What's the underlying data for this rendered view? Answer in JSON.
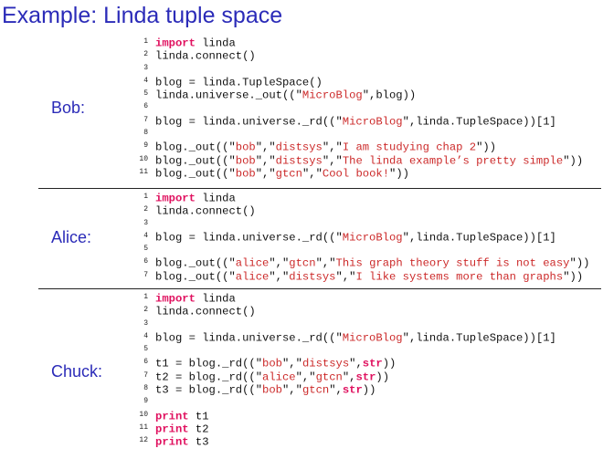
{
  "title": "Example: Linda tuple space",
  "sections": [
    {
      "speaker": "Bob:",
      "lines": [
        {
          "n": "1",
          "parts": [
            {
              "t": "import",
              "c": "kw"
            },
            {
              "t": " linda"
            }
          ]
        },
        {
          "n": "2",
          "parts": [
            {
              "t": "linda.connect()"
            }
          ]
        },
        {
          "n": "3",
          "parts": []
        },
        {
          "n": "4",
          "parts": [
            {
              "t": "blog = linda.TupleSpace()"
            }
          ]
        },
        {
          "n": "5",
          "parts": [
            {
              "t": "linda.universe._out((\""
            },
            {
              "t": "MicroBlog",
              "c": "str"
            },
            {
              "t": "\",blog))"
            }
          ]
        },
        {
          "n": "6",
          "parts": []
        },
        {
          "n": "7",
          "parts": [
            {
              "t": "blog = linda.universe._rd((\""
            },
            {
              "t": "MicroBlog",
              "c": "str"
            },
            {
              "t": "\",linda.TupleSpace))[1]"
            }
          ]
        },
        {
          "n": "8",
          "parts": []
        },
        {
          "n": "9",
          "parts": [
            {
              "t": "blog._out((\""
            },
            {
              "t": "bob",
              "c": "str"
            },
            {
              "t": "\",\""
            },
            {
              "t": "distsys",
              "c": "str"
            },
            {
              "t": "\",\""
            },
            {
              "t": "I am studying chap 2",
              "c": "str"
            },
            {
              "t": "\"))"
            }
          ]
        },
        {
          "n": "10",
          "parts": [
            {
              "t": "blog._out((\""
            },
            {
              "t": "bob",
              "c": "str"
            },
            {
              "t": "\",\""
            },
            {
              "t": "distsys",
              "c": "str"
            },
            {
              "t": "\",\""
            },
            {
              "t": "The linda example’s pretty simple",
              "c": "str"
            },
            {
              "t": "\"))"
            }
          ]
        },
        {
          "n": "11",
          "parts": [
            {
              "t": "blog._out((\""
            },
            {
              "t": "bob",
              "c": "str"
            },
            {
              "t": "\",\""
            },
            {
              "t": "gtcn",
              "c": "str"
            },
            {
              "t": "\",\""
            },
            {
              "t": "Cool book!",
              "c": "str"
            },
            {
              "t": "\"))"
            }
          ]
        }
      ]
    },
    {
      "speaker": "Alice:",
      "lines": [
        {
          "n": "1",
          "parts": [
            {
              "t": "import",
              "c": "kw"
            },
            {
              "t": " linda"
            }
          ]
        },
        {
          "n": "2",
          "parts": [
            {
              "t": "linda.connect()"
            }
          ]
        },
        {
          "n": "3",
          "parts": []
        },
        {
          "n": "4",
          "parts": [
            {
              "t": "blog = linda.universe._rd((\""
            },
            {
              "t": "MicroBlog",
              "c": "str"
            },
            {
              "t": "\",linda.TupleSpace))[1]"
            }
          ]
        },
        {
          "n": "5",
          "parts": []
        },
        {
          "n": "6",
          "parts": [
            {
              "t": "blog._out((\""
            },
            {
              "t": "alice",
              "c": "str"
            },
            {
              "t": "\",\""
            },
            {
              "t": "gtcn",
              "c": "str"
            },
            {
              "t": "\",\""
            },
            {
              "t": "This graph theory stuff is not easy",
              "c": "str"
            },
            {
              "t": "\"))"
            }
          ]
        },
        {
          "n": "7",
          "parts": [
            {
              "t": "blog._out((\""
            },
            {
              "t": "alice",
              "c": "str"
            },
            {
              "t": "\",\""
            },
            {
              "t": "distsys",
              "c": "str"
            },
            {
              "t": "\",\""
            },
            {
              "t": "I like systems more than graphs",
              "c": "str"
            },
            {
              "t": "\"))"
            }
          ]
        }
      ]
    },
    {
      "speaker": "Chuck:",
      "lines": [
        {
          "n": "1",
          "parts": [
            {
              "t": "import",
              "c": "kw"
            },
            {
              "t": " linda"
            }
          ]
        },
        {
          "n": "2",
          "parts": [
            {
              "t": "linda.connect()"
            }
          ]
        },
        {
          "n": "3",
          "parts": []
        },
        {
          "n": "4",
          "parts": [
            {
              "t": "blog = linda.universe._rd((\""
            },
            {
              "t": "MicroBlog",
              "c": "str"
            },
            {
              "t": "\",linda.TupleSpace))[1]"
            }
          ]
        },
        {
          "n": "5",
          "parts": []
        },
        {
          "n": "6",
          "parts": [
            {
              "t": "t1 = blog._rd((\""
            },
            {
              "t": "bob",
              "c": "str"
            },
            {
              "t": "\",\""
            },
            {
              "t": "distsys",
              "c": "str"
            },
            {
              "t": "\","
            },
            {
              "t": "str",
              "c": "kw"
            },
            {
              "t": "))"
            }
          ]
        },
        {
          "n": "7",
          "parts": [
            {
              "t": "t2 = blog._rd((\""
            },
            {
              "t": "alice",
              "c": "str"
            },
            {
              "t": "\",\""
            },
            {
              "t": "gtcn",
              "c": "str"
            },
            {
              "t": "\","
            },
            {
              "t": "str",
              "c": "kw"
            },
            {
              "t": "))"
            }
          ]
        },
        {
          "n": "8",
          "parts": [
            {
              "t": "t3 = blog._rd((\""
            },
            {
              "t": "bob",
              "c": "str"
            },
            {
              "t": "\",\""
            },
            {
              "t": "gtcn",
              "c": "str"
            },
            {
              "t": "\","
            },
            {
              "t": "str",
              "c": "kw"
            },
            {
              "t": "))"
            }
          ]
        },
        {
          "n": "9",
          "parts": []
        },
        {
          "n": "10",
          "parts": [
            {
              "t": "print",
              "c": "kw"
            },
            {
              "t": " t1"
            }
          ]
        },
        {
          "n": "11",
          "parts": [
            {
              "t": "print",
              "c": "kw"
            },
            {
              "t": " t2"
            }
          ]
        },
        {
          "n": "12",
          "parts": [
            {
              "t": "print",
              "c": "kw"
            },
            {
              "t": " t3"
            }
          ]
        }
      ]
    }
  ]
}
